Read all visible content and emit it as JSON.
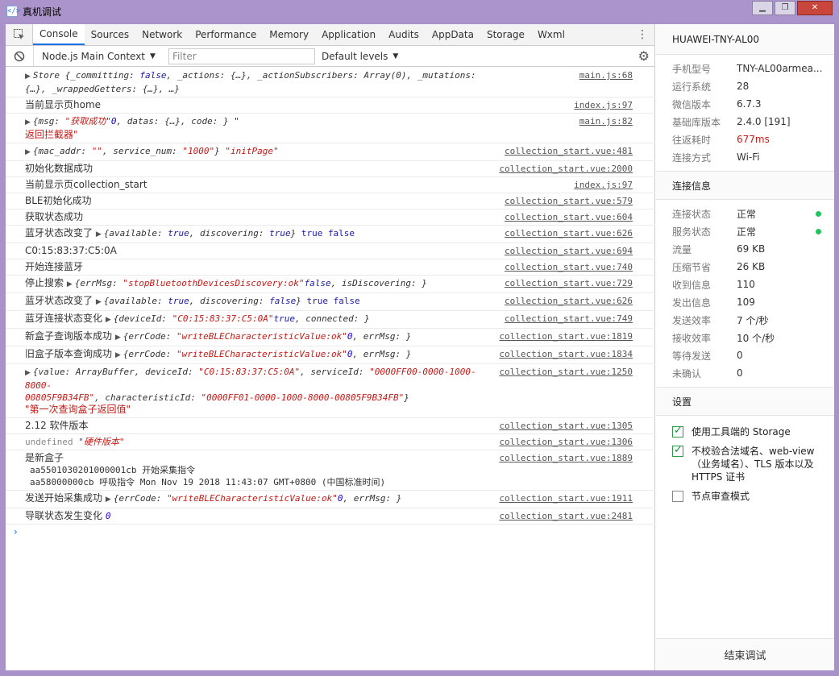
{
  "window": {
    "title": "真机调试",
    "icon_glyph": "</>",
    "controls": [
      "▁",
      "❐",
      "✕"
    ]
  },
  "tabs": [
    "Console",
    "Sources",
    "Network",
    "Performance",
    "Memory",
    "Application",
    "Audits",
    "AppData",
    "Storage",
    "Wxml"
  ],
  "toolbar": {
    "context": "Node.js Main Context",
    "filter_placeholder": "Filter",
    "levels": "Default levels"
  },
  "logs": [
    {
      "src": "main.js:68",
      "tri": "▶",
      "pre": "Store {_committing: ",
      "kw1": "false",
      "rest": ", _actions: {…}, _actionSubscribers: Array(0), _mutations: {…}, _wrappedGetters: {…}, …}",
      "str": "\"store\""
    },
    {
      "src": "index.js:97",
      "text": "当前显示页home"
    },
    {
      "src": "main.js:82",
      "tri": "▶",
      "obj": "{msg: ",
      "s1": "\"获取成功\"",
      "obj2": ", datas: {…}, code: ",
      "n1": "0",
      "obj3": "} \"",
      "line2": "返回拦截器\""
    },
    {
      "src": "collection_start.vue:481",
      "tri": "▶",
      "obj": "{mac_addr: ",
      "s1": "\"\"",
      "obj2": ", service_num: ",
      "s2": "\"1000\"",
      "obj3": "}",
      "s3": " \"initPage\""
    },
    {
      "src": "collection_start.vue:2000",
      "text": "初始化数据成功"
    },
    {
      "src": "index.js:97",
      "text": "当前显示页collection_start"
    },
    {
      "src": "collection_start.vue:579",
      "text": "BLE初始化成功"
    },
    {
      "src": "collection_start.vue:604",
      "text": "获取状态成功"
    },
    {
      "src": "collection_start.vue:626",
      "lead": "蓝牙状态改变了 ",
      "tri": "▶",
      "obj": "{available: ",
      "k1": "true",
      "obj2": ", discovering: ",
      "k2": "true",
      "obj3": "}",
      "tail": " true false"
    },
    {
      "src": "collection_start.vue:694",
      "text": "C0:15:83:37:C5:0A"
    },
    {
      "src": "collection_start.vue:740",
      "text": "开始连接蓝牙"
    },
    {
      "src": "collection_start.vue:729",
      "lead": "停止搜索 ",
      "tri": "▶",
      "obj": "{errMsg: ",
      "s1": "\"stopBluetoothDevicesDiscovery:ok\"",
      "obj2": ", isDiscovering: ",
      "k1": "false",
      "obj3": "}"
    },
    {
      "src": "collection_start.vue:626",
      "lead": "蓝牙状态改变了 ",
      "tri": "▶",
      "obj": "{available: ",
      "k1": "true",
      "obj2": ", discovering: ",
      "k2": "false",
      "obj3": "}",
      "tail": " true false"
    },
    {
      "src": "collection_start.vue:749",
      "lead": "蓝牙连接状态变化 ",
      "tri": "▶",
      "obj": "{deviceId: ",
      "s1": "\"C0:15:83:37:C5:0A\"",
      "obj2": ", connected: ",
      "k1": "true",
      "obj3": "}"
    },
    {
      "src": "collection_start.vue:1819",
      "lead": "新盒子查询版本成功 ",
      "tri": "▶",
      "obj": "{errCode: ",
      "n1": "0",
      "obj2": ", errMsg: ",
      "s1": "\"writeBLECharacteristicValue:ok\"",
      "obj3": "}"
    },
    {
      "src": "collection_start.vue:1834",
      "lead": "旧盒子版本查询成功 ",
      "tri": "▶",
      "obj": "{errCode: ",
      "n1": "0",
      "obj2": ", errMsg: ",
      "s1": "\"writeBLECharacteristicValue:ok\"",
      "obj3": "}"
    },
    {
      "src": "collection_start.vue:1250",
      "tri": "▶",
      "l1": "{value: ArrayBuffer, deviceId: ",
      "l1s": "\"C0:15:83:37:C5:0A\"",
      "l1b": ", serviceId: ",
      "l1s2": "\"0000FF00-0000-1000-8000-",
      "l2s": "00805F9B34FB\"",
      "l2b": ", characteristicId: ",
      "l2s2": "\"0000FF01-0000-1000-8000-00805F9B34FB\"",
      "l2c": "}",
      "l3": "\"第一次查询盒子返回值\""
    },
    {
      "src": "collection_start.vue:1305",
      "text": "2.12 软件版本"
    },
    {
      "src": "collection_start.vue:1306",
      "gray": "undefined",
      "s1": " \"硬件版本\""
    },
    {
      "src": "collection_start.vue:1889",
      "text": "是新盒子",
      "line2": "aa5501030201000001cb 开始采集指令",
      "line3": "aa58000000cb 呼吸指令 Mon Nov 19 2018 11:43:07 GMT+0800 (中国标准时间)"
    },
    {
      "src": "collection_start.vue:1911",
      "lead": "发送开始采集成功 ",
      "tri": "▶",
      "obj": "{errCode: ",
      "n1": "0",
      "obj2": ", errMsg: ",
      "s1": "\"writeBLECharacteristicValue:ok\"",
      "obj3": "}"
    },
    {
      "src": "collection_start.vue:2481",
      "lead": "导联状态发生变化 ",
      "n1": "0"
    }
  ],
  "prompt": "›",
  "side": {
    "device": "HUAWEI-TNY-AL00",
    "info": [
      {
        "k": "手机型号",
        "v": "TNY-AL00armea..."
      },
      {
        "k": "运行系统",
        "v": "28"
      },
      {
        "k": "微信版本",
        "v": "6.7.3"
      },
      {
        "k": "基础库版本",
        "v": "2.4.0 [191]"
      },
      {
        "k": "往返耗时",
        "v": "677ms",
        "red": true
      },
      {
        "k": "连接方式",
        "v": "Wi-Fi"
      }
    ],
    "conn_title": "连接信息",
    "conn": [
      {
        "k": "连接状态",
        "v": "正常",
        "dot": true
      },
      {
        "k": "服务状态",
        "v": "正常",
        "dot": true
      },
      {
        "k": "流量",
        "v": "69 KB"
      },
      {
        "k": "压缩节省",
        "v": "26 KB"
      },
      {
        "k": "收到信息",
        "v": "110"
      },
      {
        "k": "发出信息",
        "v": "109"
      },
      {
        "k": "发送效率",
        "v": "7 个/秒"
      },
      {
        "k": "接收效率",
        "v": "10 个/秒"
      },
      {
        "k": "等待发送",
        "v": "0"
      },
      {
        "k": "未确认",
        "v": "0"
      }
    ],
    "settings_title": "设置",
    "settings": [
      {
        "label": "使用工具端的 Storage",
        "checked": true
      },
      {
        "label": "不校验合法域名、web-view（业务域名）、TLS 版本以及 HTTPS 证书",
        "checked": true
      },
      {
        "label": "节点审查模式",
        "checked": false
      }
    ],
    "end_button": "结束调试"
  }
}
